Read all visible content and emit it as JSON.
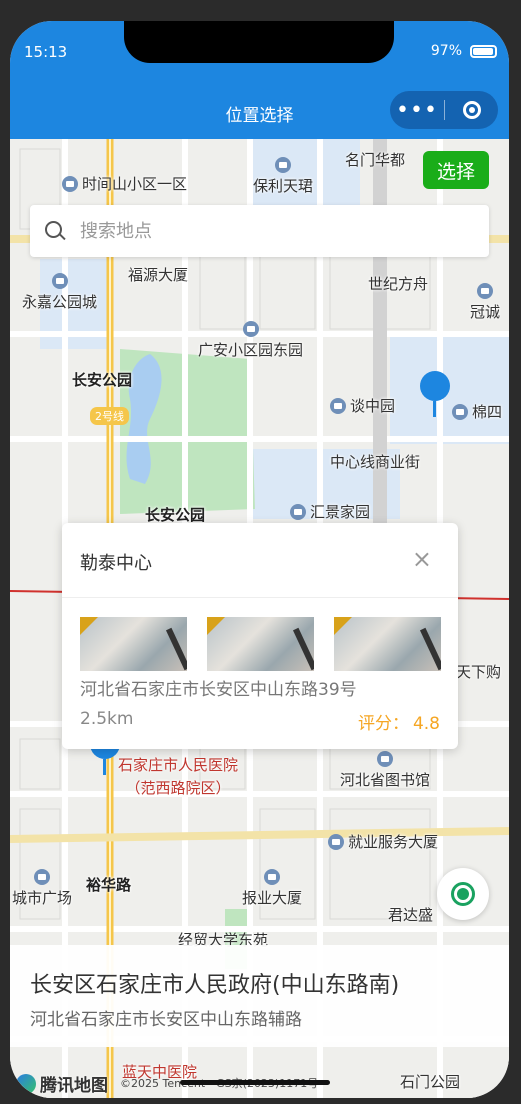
{
  "status": {
    "time": "15:13",
    "battery": "97%"
  },
  "nav": {
    "title": "位置选择",
    "more_label": "•••"
  },
  "map": {
    "select_button": "选择",
    "search_placeholder": "搜索地点",
    "labels": [
      "时间山小区一区",
      "保利天珺",
      "名门华都",
      "福源大厦",
      "世纪方舟",
      "永嘉公园城",
      "冠诚",
      "广安小区园东园",
      "谈中园",
      "棉四",
      "长安公园",
      "中心线商业街",
      "长安公园",
      "汇景家园",
      "石家庄市人民医院",
      "（范西路院区）",
      "河北省图书馆",
      "就业服务大厦",
      "裕华路",
      "报业大厦",
      "君达盛",
      "城市广场",
      "经贸大学东苑",
      "蓝天中医院",
      "石门公园",
      "天下购",
      "2号线"
    ]
  },
  "popup": {
    "title": "勒泰中心",
    "close": "×",
    "address": "河北省石家庄市长安区中山东路39号",
    "distance": "2.5km",
    "rating_label": "评分：",
    "rating_value": "4.8"
  },
  "selected": {
    "name": "长安区石家庄市人民政府(中山东路南)",
    "address": "河北省石家庄市长安区中山东路辅路"
  },
  "footer": {
    "logo": "腾讯地图",
    "copyright": "©2025 Tencent - GS京(2023)1171号"
  }
}
